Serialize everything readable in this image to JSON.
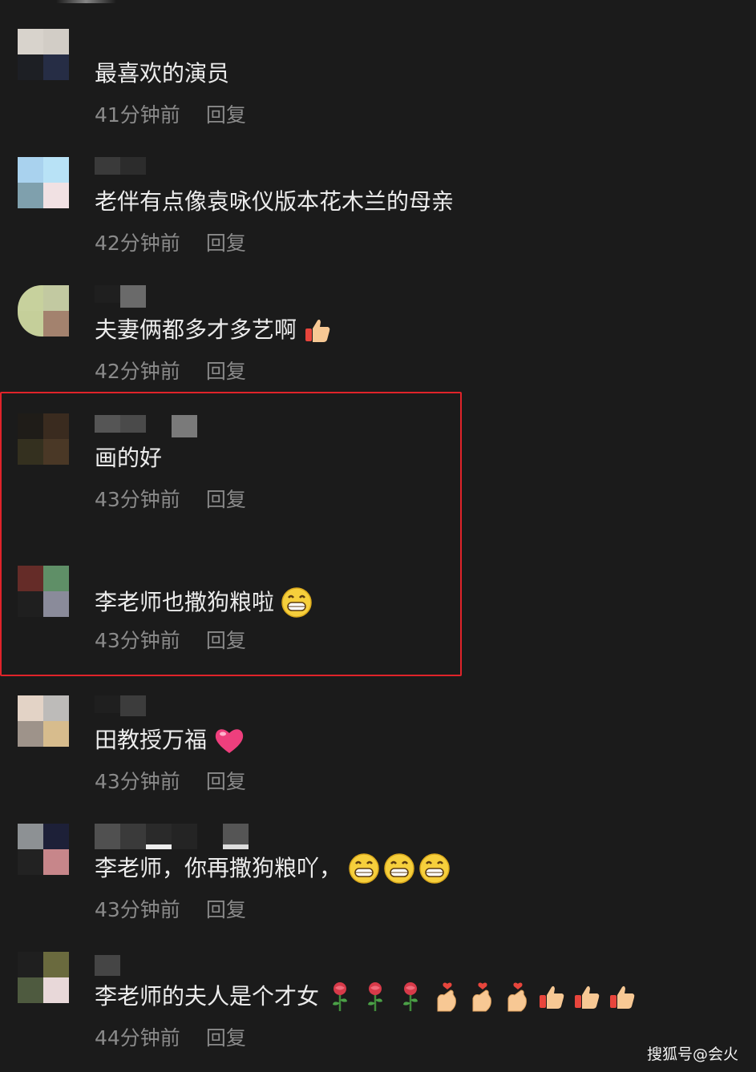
{
  "comments": [
    {
      "text": "最喜欢的演员",
      "time": "41分钟前",
      "reply": "回复"
    },
    {
      "text": "老伴有点像袁咏仪版本花木兰的母亲",
      "time": "42分钟前",
      "reply": "回复"
    },
    {
      "text": "夫妻俩都多才多艺啊",
      "time": "42分钟前",
      "reply": "回复",
      "emojis": [
        "thumbs-up"
      ]
    },
    {
      "text": "画的好",
      "time": "43分钟前",
      "reply": "回复"
    },
    {
      "text": "李老师也撒狗粮啦",
      "time": "43分钟前",
      "reply": "回复",
      "emojis": [
        "grin"
      ]
    },
    {
      "text": "田教授万福",
      "time": "43分钟前",
      "reply": "回复",
      "emojis": [
        "heart"
      ]
    },
    {
      "text": "李老师，你再撒狗粮吖，",
      "time": "43分钟前",
      "reply": "回复",
      "emojis": [
        "grin",
        "grin",
        "grin"
      ]
    },
    {
      "text": "李老师的夫人是个才女",
      "time": "44分钟前",
      "reply": "回复",
      "emojis": [
        "rose",
        "rose",
        "rose",
        "finger-heart",
        "finger-heart",
        "finger-heart",
        "thumbs-up",
        "thumbs-up",
        "thumbs-up"
      ]
    }
  ],
  "watermark": "搜狐号@会火",
  "colors": {
    "background": "#1b1b1b",
    "highlight": "#e0232a",
    "meta_text": "#8a8a8a"
  }
}
